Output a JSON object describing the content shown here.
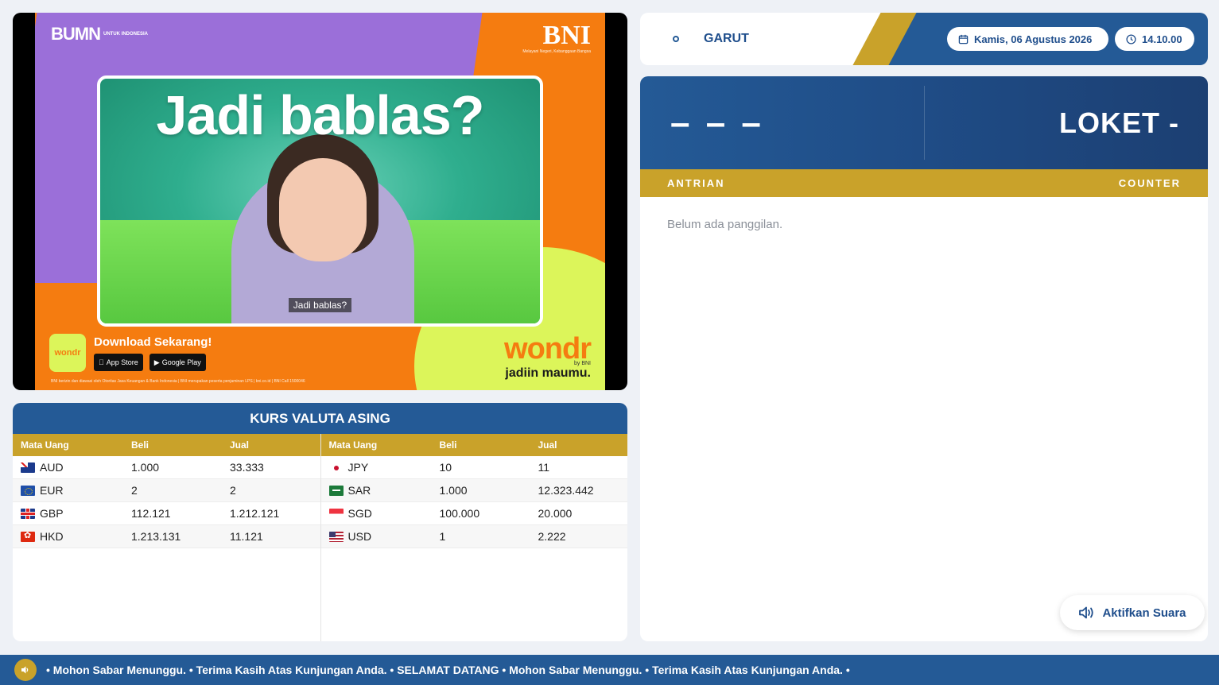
{
  "video": {
    "bumn_logo": "BUMN",
    "bumn_sub": "UNTUK INDONESIA",
    "bni_logo": "BNI",
    "bni_tagline": "Melayani Negeri, Kebanggaan Bangsa",
    "headline": "Jadi bablas?",
    "caption": "Jadi bablas?",
    "app_icon_label": "wondr",
    "download_title": "Download Sekarang!",
    "app_store_label": "App Store",
    "google_play_label": "Google Play",
    "wondr_brand": "wondr",
    "wondr_by": "by BNI",
    "wondr_tagline": "jadiin maumu.",
    "disclaimer": "BNI berizin dan diawasi oleh Otoritas Jasa Keuangan & Bank Indonesia | BNI merupakan peserta penjaminan LPS | bni.co.id | BNI Call 1500046"
  },
  "kurs": {
    "title": "KURS VALUTA ASING",
    "headers": [
      "Mata Uang",
      "Beli",
      "Jual"
    ],
    "left": [
      {
        "code": "AUD",
        "flag": "flag-aud",
        "beli": "1.000",
        "jual": "33.333"
      },
      {
        "code": "EUR",
        "flag": "flag-eur",
        "beli": "2",
        "jual": "2"
      },
      {
        "code": "GBP",
        "flag": "flag-gbp",
        "beli": "112.121",
        "jual": "1.212.121"
      },
      {
        "code": "HKD",
        "flag": "flag-hkd",
        "beli": "1.213.131",
        "jual": "11.121"
      }
    ],
    "right": [
      {
        "code": "JPY",
        "flag": "flag-jpy",
        "beli": "10",
        "jual": "11"
      },
      {
        "code": "SAR",
        "flag": "flag-sar",
        "beli": "1.000",
        "jual": "12.323.442"
      },
      {
        "code": "SGD",
        "flag": "flag-sgd",
        "beli": "100.000",
        "jual": "20.000"
      },
      {
        "code": "USD",
        "flag": "flag-usd",
        "beli": "1",
        "jual": "2.222"
      }
    ]
  },
  "header": {
    "branch": "GARUT",
    "date": "Kamis, 06 Agustus 2026",
    "time": "14.10.00"
  },
  "queue": {
    "number": "– – –",
    "counter": "LOKET -",
    "label_antrian": "ANTRIAN",
    "label_counter": "COUNTER",
    "empty_message": "Belum ada panggilan.",
    "sound_button": "Aktifkan Suara"
  },
  "ticker": {
    "text": "• Mohon Sabar Menunggu. • Terima Kasih Atas Kunjungan Anda. • SELAMAT DATANG • Mohon Sabar Menunggu. • Terima Kasih Atas Kunjungan Anda. •"
  },
  "colors": {
    "primary_blue": "#245a96",
    "gold": "#c9a22a",
    "orange": "#f57c10",
    "lime": "#dcf55a",
    "purple": "#9b6fd9"
  }
}
